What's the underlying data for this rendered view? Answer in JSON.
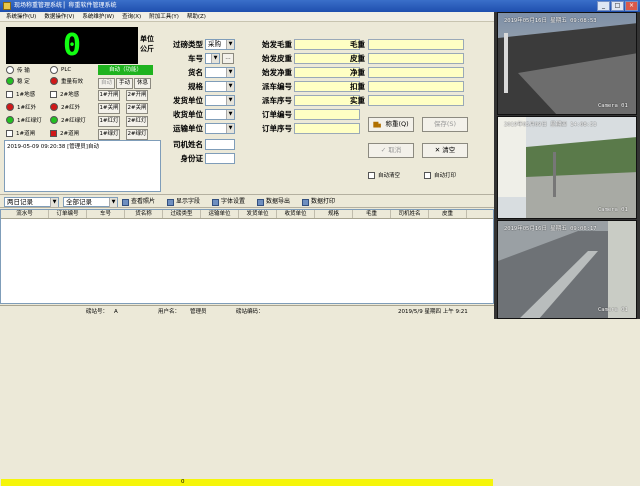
{
  "window": {
    "title": "现场称重管理系统 ▏称重软件管理系统",
    "min": "_",
    "max": "□",
    "close": "×"
  },
  "menu": [
    "系统操作(U)",
    "数据操作(V)",
    "系统维护(W)",
    "查询(X)",
    "附加工具(Y)",
    "帮助(Z)"
  ],
  "weight": {
    "value": "0",
    "unit": "单位\n公斤"
  },
  "lamps": {
    "transport": "传  输",
    "plc": "PLC",
    "stable": "稳  定",
    "weight_valid": "重量有效",
    "gate1": "1#地感",
    "gate2": "2#地感",
    "red1": "1#红外",
    "red2": "2#红外",
    "light1": "1#红绿灯",
    "light2": "2#红绿灯",
    "brake1": "1#道闸",
    "brake2": "2#道闸"
  },
  "controls": {
    "auto_mode": "自动（功能）",
    "auto": "自动",
    "manual": "手动",
    "rest": "休息",
    "open1": "1#开闸",
    "open2": "2#开闸",
    "close1": "1#关闸",
    "close2": "2#关闸",
    "red1": "1#红灯",
    "red2": "2#红灯",
    "green1": "1#绿灯",
    "green2": "2#绿灯"
  },
  "log": "2019-05-09 09:20:38 [管理员]自动",
  "fields_left": [
    {
      "label": "过磅类型",
      "value": "采购",
      "kind": "select"
    },
    {
      "label": "车号",
      "value": "",
      "kind": "plate"
    },
    {
      "label": "货名",
      "value": "",
      "kind": "select"
    },
    {
      "label": "规格",
      "value": "",
      "kind": "select"
    },
    {
      "label": "发货单位",
      "value": "",
      "kind": "select"
    },
    {
      "label": "收货单位",
      "value": "",
      "kind": "select"
    },
    {
      "label": "运输单位",
      "value": "",
      "kind": "select"
    },
    {
      "label": "司机姓名",
      "value": "",
      "kind": "input"
    },
    {
      "label": "身份证",
      "value": "",
      "kind": "input"
    }
  ],
  "fields_mid": [
    "始发毛重",
    "始发皮重",
    "始发净重",
    "派车编号",
    "派车序号",
    "订单编号",
    "订单序号"
  ],
  "fields_right": [
    "毛重",
    "皮重",
    "净重",
    "扣重",
    "实重"
  ],
  "actions": {
    "weigh": "称重(Q)",
    "save": "保存(S)",
    "cancel": "取消",
    "clear": "清空",
    "auto_clear": "自动清空",
    "auto_print": "自动打印"
  },
  "toolbar": {
    "filter1": "两日记录",
    "filter2": "全部记录",
    "view_photo": "查看照片",
    "show_fields": "显示字段",
    "font_settings": "字体设置",
    "export": "数据导出",
    "print": "数据打印"
  },
  "grid": {
    "columns": [
      "流水号",
      "订单编号",
      "车号",
      "货名称",
      "过磅类型",
      "运输单位",
      "发货单位",
      "收货单位",
      "规格",
      "毛重",
      "司机姓名",
      "皮重"
    ],
    "sum": "0"
  },
  "status": {
    "station_label": "磅站号：",
    "station": "A",
    "user_label": "用户名：",
    "user": "管理员",
    "code_label": "磅站编码：",
    "datetime": "2019/5/9  星期四  上午 9:21"
  },
  "cameras": [
    {
      "timestamp": "2019年05月16日 星期五 09:08:53",
      "name": "Camera 01"
    },
    {
      "timestamp": "2019年05月09日 星期四 14:08:53",
      "name": "Camera 01"
    },
    {
      "timestamp": "2019年05月16日 星期五 09:06:17",
      "name": "Camera 01"
    }
  ]
}
